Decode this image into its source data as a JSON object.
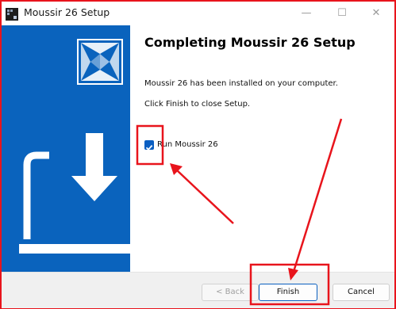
{
  "window": {
    "title": "Moussir 26 Setup",
    "minimize_icon": "minimize-icon",
    "maximize_icon": "maximize-icon",
    "close_icon": "close-icon"
  },
  "page": {
    "heading": "Completing Moussir 26 Setup",
    "installed_text": "Moussir 26 has been installed on your computer.",
    "close_text": "Click Finish to close Setup.",
    "run_checkbox": {
      "label": "Run Moussir 26",
      "checked": true
    }
  },
  "buttons": {
    "back": "< Back",
    "finish": "Finish",
    "cancel": "Cancel"
  },
  "colors": {
    "side_panel": "#0a63bd",
    "annotation": "#e8141c",
    "accent": "#0b5fc2"
  }
}
